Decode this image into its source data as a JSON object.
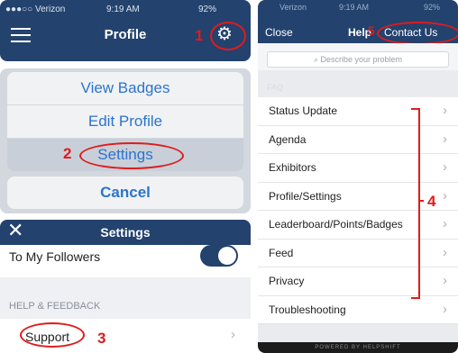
{
  "profile_panel": {
    "status": {
      "carrier": "●●●○○ Verizon",
      "time": "9:19 AM",
      "battery": "92%"
    },
    "title": "Profile",
    "annotation": "1"
  },
  "action_sheet": {
    "items": [
      "View Badges",
      "Edit Profile",
      "Settings"
    ],
    "cancel": "Cancel",
    "annotation": "2"
  },
  "settings_panel": {
    "title": "Settings",
    "close_glyph": "✕",
    "toggle_row": "To My Followers",
    "toggle_on": true,
    "section_header": "HELP & FEEDBACK",
    "support_row": "Support",
    "annotation": "3"
  },
  "help_panel": {
    "status": {
      "carrier": "Verizon",
      "time": "9:19 AM",
      "battery": "92%"
    },
    "close": "Close",
    "title": "Help",
    "contact": "Contact Us",
    "contact_annotation": "5",
    "search_placeholder": "Describe your problem",
    "faq_header": "FAQ",
    "items": [
      "Status Update",
      "Agenda",
      "Exhibitors",
      "Profile/Settings",
      "Leaderboard/Points/Badges",
      "Feed",
      "Privacy",
      "Troubleshooting"
    ],
    "list_annotation": "4",
    "footer": "POWERED BY HELPSHIFT"
  },
  "colors": {
    "navy": "#23426e",
    "annotation_red": "#e01b1b",
    "ios_blue": "#2a74d0"
  }
}
